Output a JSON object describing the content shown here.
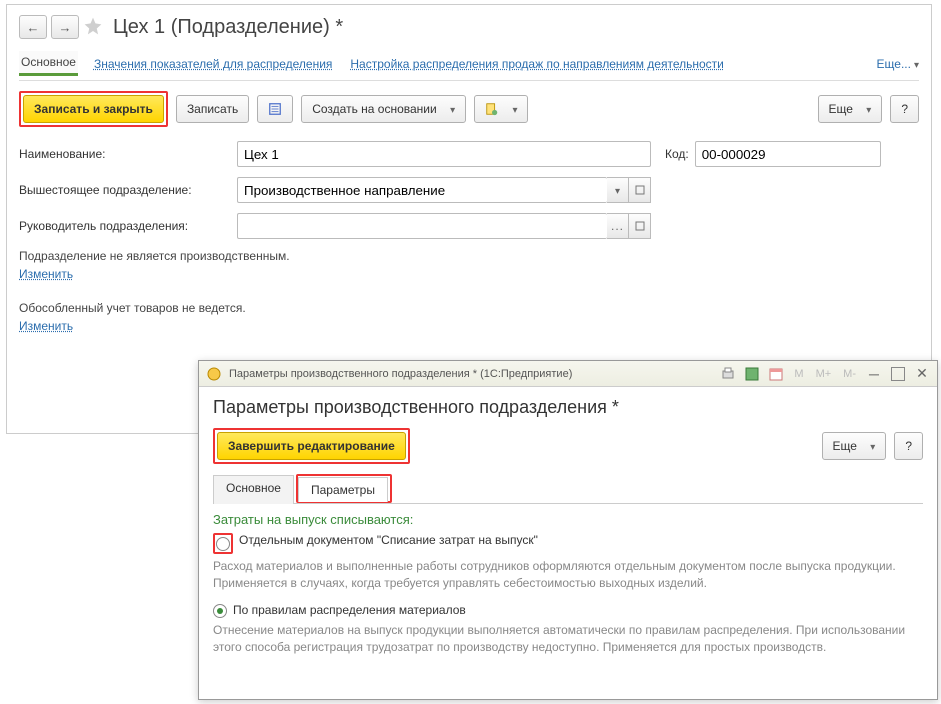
{
  "main": {
    "title": "Цех 1 (Подразделение) *",
    "tabs": {
      "main": "Основное",
      "indicators": "Значения показателей для распределения",
      "sales": "Настройка распределения продаж по направлениям деятельности",
      "more": "Еще..."
    },
    "toolbar": {
      "write_close": "Записать и закрыть",
      "write": "Записать",
      "create_based": "Создать на основании",
      "more": "Еще",
      "help": "?"
    },
    "fields": {
      "name_label": "Наименование:",
      "name_value": "Цех 1",
      "code_label": "Код:",
      "code_value": "00-000029",
      "parent_label": "Вышестоящее подразделение:",
      "parent_value": "Производственное направление",
      "manager_label": "Руководитель подразделения:",
      "manager_value": ""
    },
    "info1": "Подразделение не является производственным.",
    "change": "Изменить",
    "info2": "Обособленный учет товаров не ведется."
  },
  "dialog": {
    "titlebar": "Параметры производственного подразделения * (1С:Предприятие)",
    "m_labels": {
      "m": "M",
      "mp": "M+",
      "mm": "M-"
    },
    "heading": "Параметры производственного подразделения *",
    "finish": "Завершить редактирование",
    "more": "Еще",
    "help": "?",
    "tabs": {
      "main": "Основное",
      "params": "Параметры"
    },
    "section": "Затраты на выпуск списываются:",
    "opt1": "Отдельным документом \"Списание затрат на выпуск\"",
    "opt1_help": "Расход материалов и выполненные работы сотрудников оформляются отдельным документом после выпуска продукции. Применяется в случаях, когда требуется управлять себестоимостью выходных изделий.",
    "opt2": "По правилам распределения материалов",
    "opt2_help": "Отнесение материалов на выпуск продукции выполняется автоматически по правилам распределения. При использовании этого способа регистрация трудозатрат по производству недоступно. Применяется для простых производств."
  }
}
